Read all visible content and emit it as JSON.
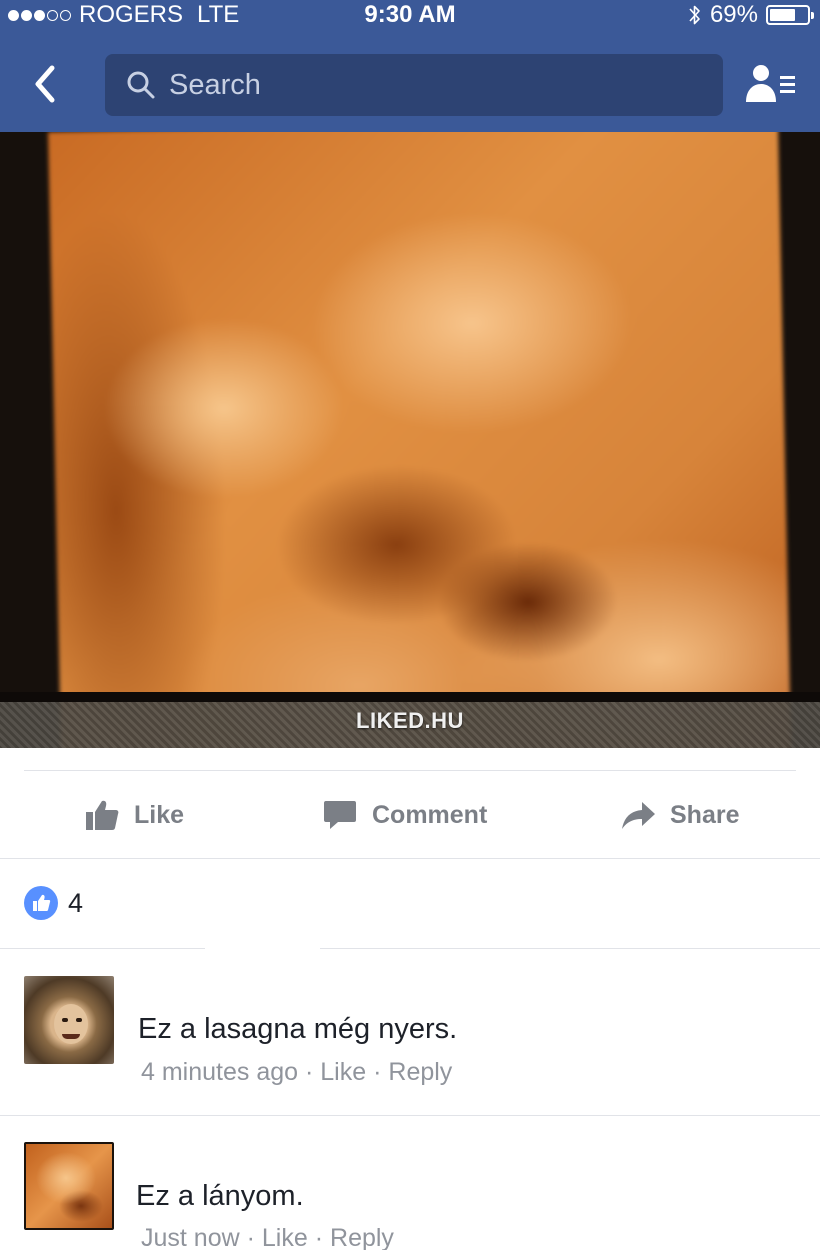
{
  "status_bar": {
    "carrier": "ROGERS",
    "network": "LTE",
    "time": "9:30 AM",
    "battery_percent": "69%",
    "battery_level": 0.69
  },
  "nav": {
    "search_placeholder": "Search",
    "back_icon": "chevron-left-icon",
    "friends_icon": "friend-list-icon"
  },
  "post": {
    "watermark": "LIKED.HU",
    "actions": {
      "like": "Like",
      "comment": "Comment",
      "share": "Share"
    },
    "reaction_count": "4"
  },
  "comments": [
    {
      "text": "Ez a lasagna még nyers.",
      "time": "4 minutes ago",
      "sep": "·",
      "like": "Like",
      "reply": "Reply"
    },
    {
      "text": "Ez a lányom.",
      "time": "Just now",
      "sep": "·",
      "like": "Like",
      "reply": "Reply"
    }
  ],
  "colors": {
    "brand_blue": "#3b5998",
    "search_bg": "#2d4373",
    "action_gray": "#7b7f86",
    "meta_gray": "#90949c",
    "like_badge": "#5890ff"
  }
}
